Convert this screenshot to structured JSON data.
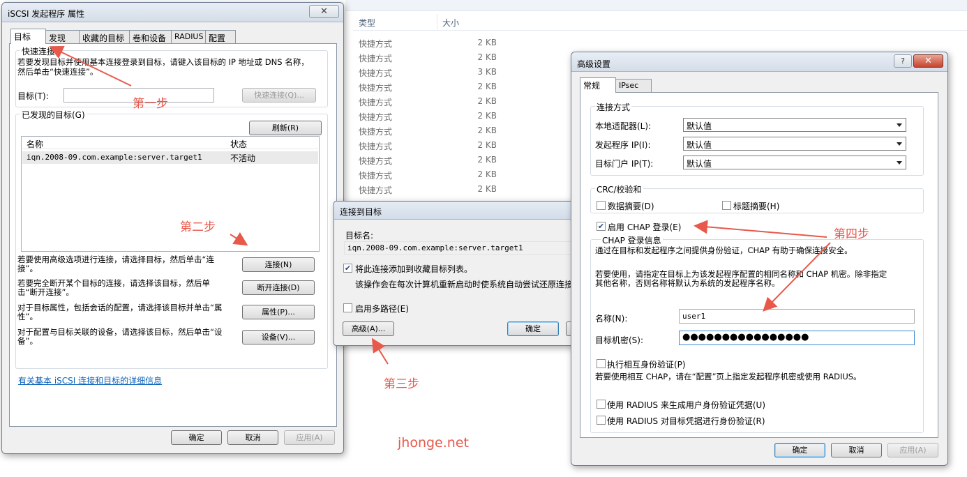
{
  "background": {
    "col_type": "类型",
    "col_size": "大小",
    "rows": [
      {
        "type": "快捷方式",
        "size": "2 KB"
      },
      {
        "type": "快捷方式",
        "size": "2 KB"
      },
      {
        "type": "快捷方式",
        "size": "3 KB"
      },
      {
        "type": "快捷方式",
        "size": "2 KB"
      },
      {
        "type": "快捷方式",
        "size": "2 KB"
      },
      {
        "type": "快捷方式",
        "size": "2 KB"
      },
      {
        "type": "快捷方式",
        "size": "2 KB"
      },
      {
        "type": "快捷方式",
        "size": "2 KB"
      },
      {
        "type": "快捷方式",
        "size": "2 KB"
      },
      {
        "type": "快捷方式",
        "size": "2 KB"
      },
      {
        "type": "快捷方式",
        "size": "2 KB"
      }
    ]
  },
  "iscsi": {
    "title": "iSCSI 发起程序 属性",
    "close_label": "✕",
    "tabs": [
      "目标",
      "发现",
      "收藏的目标",
      "卷和设备",
      "RADIUS",
      "配置"
    ],
    "quick": {
      "group_title": "快速连接",
      "desc": "若要发现目标并使用基本连接登录到目标，请键入该目标的 IP 地址或 DNS 名称，然后单击“快速连接”。",
      "target_label": "目标(T):",
      "target_value": "",
      "quick_button": "快速连接(Q)..."
    },
    "discovered": {
      "group_title": "已发现的目标(G)",
      "refresh_button": "刷新(R)",
      "col_name": "名称",
      "col_status": "状态",
      "rows": [
        {
          "name": "iqn.2008-09.com.example:server.target1",
          "status": "不活动"
        }
      ]
    },
    "actions": [
      {
        "desc": "若要使用高级选项进行连接，请选择目标，然后单击“连接”。",
        "button": "连接(N)"
      },
      {
        "desc": "若要完全断开某个目标的连接，请选择该目标，然后单击“断开连接”。",
        "button": "断开连接(D)"
      },
      {
        "desc": "对于目标属性，包括会话的配置，请选择该目标并单击“属性”。",
        "button": "属性(P)..."
      },
      {
        "desc": "对于配置与目标关联的设备，请选择该目标，然后单击“设备”。",
        "button": "设备(V)..."
      }
    ],
    "more_link": "有关基本 iSCSI 连接和目标的详细信息",
    "ok": "确定",
    "cancel": "取消",
    "apply": "应用(A)"
  },
  "connect": {
    "title": "连接到目标",
    "target_name_label": "目标名:",
    "target_name_value": "iqn.2008-09.com.example:server.target1",
    "add_favorites": "将此连接添加到收藏目标列表。",
    "add_favorites_note": "该操作会在每次计算机重新启动时使系统自动尝试还原连接。",
    "multipath": "启用多路径(E)",
    "advanced_button": "高级(A)...",
    "ok": "确定"
  },
  "advanced": {
    "title": "高级设置",
    "help_label": "?",
    "close_label": "✕",
    "tabs": [
      "常规",
      "IPsec"
    ],
    "conn_group": "连接方式",
    "local_adapter_label": "本地适配器(L):",
    "local_adapter_value": "默认值",
    "initiator_ip_label": "发起程序 IP(I):",
    "initiator_ip_value": "默认值",
    "portal_ip_label": "目标门户 IP(T):",
    "portal_ip_value": "默认值",
    "crc_group": "CRC/校验和",
    "data_digest": "数据摘要(D)",
    "header_digest": "标题摘要(H)",
    "chap_enable": "启用 CHAP 登录(E)",
    "chap_group": "CHAP 登录信息",
    "chap_desc1": "通过在目标和发起程序之间提供身份验证，CHAP 有助于确保连接安全。",
    "chap_desc2a": "若要使用，请指定在目标上为该发起程序配置的相同名称和 CHAP 机密。除非指定",
    "chap_desc2b": "其他名称，否则名称将默认为系统的发起程序名称。",
    "name_label": "名称(N):",
    "name_value": "user1",
    "secret_label": "目标机密(S):",
    "secret_value": "●●●●●●●●●●●●●●●●",
    "mutual": "执行相互身份验证(P)",
    "mutual_desc": "若要使用相互 CHAP，请在“配置”页上指定发起程序机密或使用 RADIUS。",
    "radius1": "使用 RADIUS 来生成用户身份验证凭据(U)",
    "radius2": "使用 RADIUS 对目标凭据进行身份验证(R)",
    "ok": "确定",
    "cancel": "取消",
    "apply": "应用(A)"
  },
  "annotations": {
    "step1": "第一步",
    "step2": "第二步",
    "step3": "第三步",
    "step4": "第四步",
    "watermark": "jhonge.net",
    "color": "#e8584b"
  }
}
